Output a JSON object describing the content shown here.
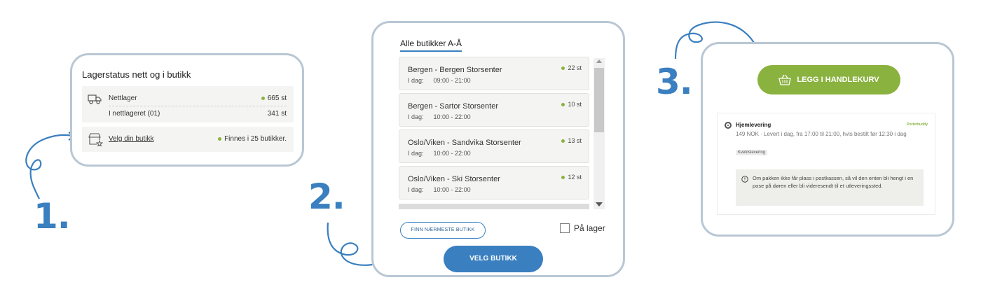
{
  "steps": [
    "1.",
    "2.",
    "3."
  ],
  "panel1": {
    "title": "Lagerstatus nett og i butikk",
    "nettlager": {
      "label": "Nettlager",
      "qty": "665 st"
    },
    "sub": {
      "label": "I nettlageret (01)",
      "qty": "341 st"
    },
    "butikk": {
      "link": "Velg din butikk",
      "status": "Finnes i 25 butikker."
    },
    "icons": [
      "truck-icon",
      "store-icon"
    ]
  },
  "panel2": {
    "title": "Alle butikker A-Å",
    "stores": [
      {
        "name": "Bergen - Bergen Storsenter",
        "day": "I dag:",
        "hours": "09:00 - 21:00",
        "qty": "22 st"
      },
      {
        "name": "Bergen - Sartor Storsenter",
        "day": "I dag:",
        "hours": "10:00 - 22:00",
        "qty": "10 st"
      },
      {
        "name": "Oslo/Viken - Sandvika Storsenter",
        "day": "I dag:",
        "hours": "10:00 - 22:00",
        "qty": "13 st"
      },
      {
        "name": "Oslo/Viken - Ski Storsenter",
        "day": "I dag:",
        "hours": "10:00 - 22:00",
        "qty": "12 st"
      }
    ],
    "finn_button": "FINN NÆRMESTE BUTIKK",
    "checkbox_label": "På lager",
    "velg_button": "VELG BUTIKK"
  },
  "panel3": {
    "cart_button": "LEGG I HANDLEKURV",
    "delivery": {
      "title": "Hjemlevering",
      "details": "149 NOK · Levert i dag, fra 17:00 til 21:00, hvis bestilt før 12:30 i dag",
      "badge": "Kveldslevering",
      "carrier": "Porterbuddy",
      "info": "Om pakken ikke får plass i postkassen, så vil den enten bli hengt i en pose på døren eller bli videresendt til et utleveringssted."
    }
  },
  "colors": {
    "accent_blue": "#3a7fc0",
    "green": "#8ab23f",
    "border": "#b9c7d4"
  }
}
